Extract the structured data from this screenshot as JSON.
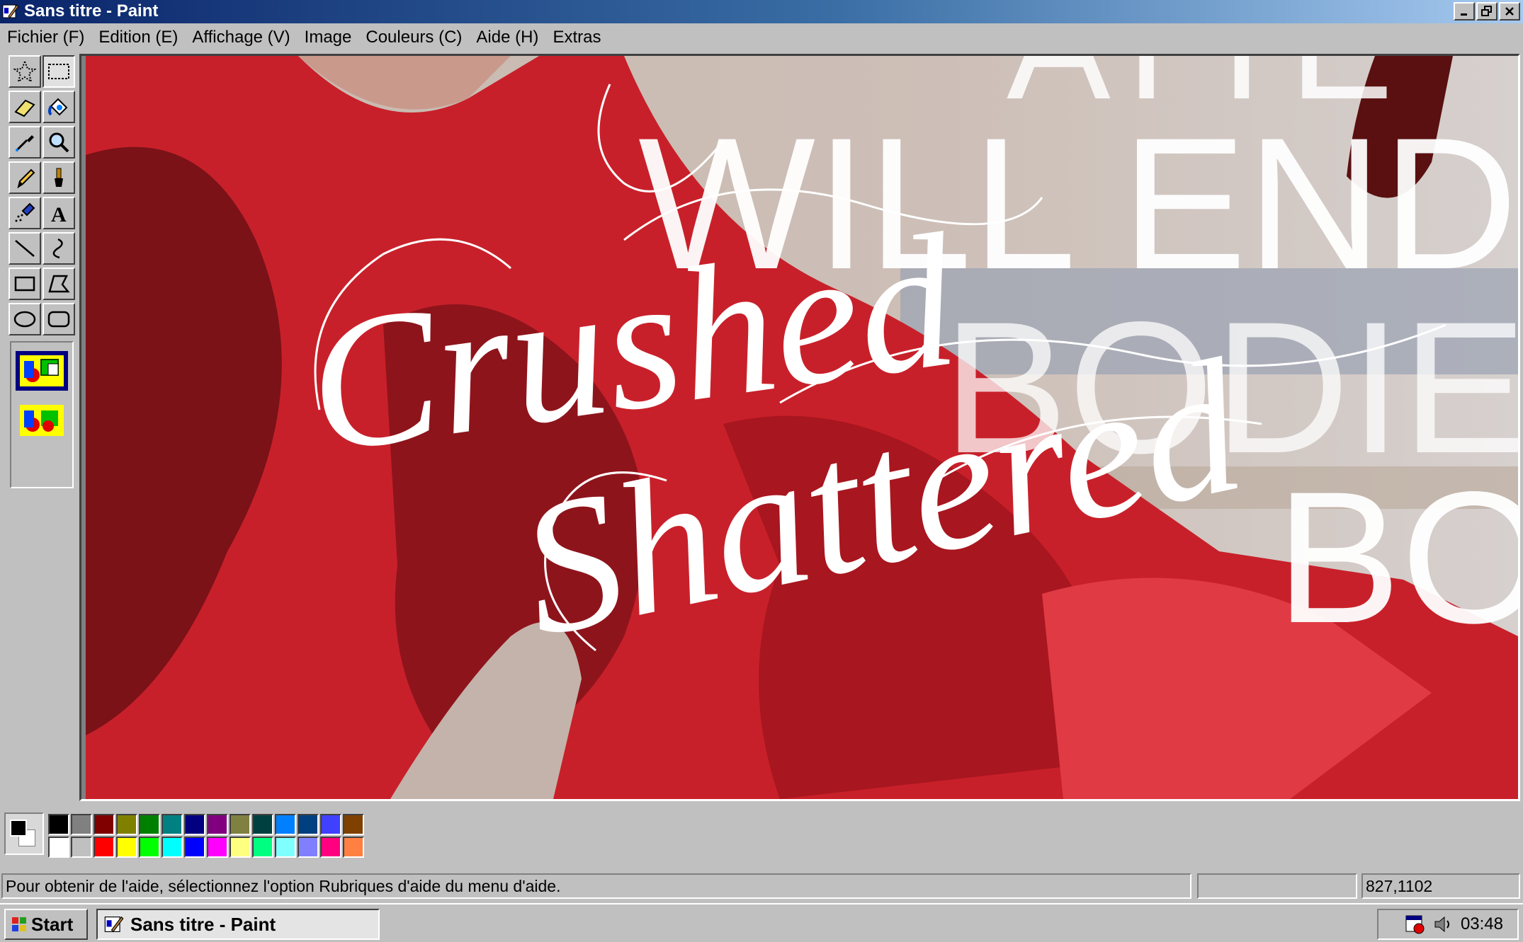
{
  "window": {
    "title": "Sans titre - Paint"
  },
  "menu": [
    "Fichier (F)",
    "Edition (E)",
    "Affichage (V)",
    "Image",
    "Couleurs (C)",
    "Aide (H)",
    "Extras"
  ],
  "tools": [
    {
      "name": "free-select",
      "icon": "star-select-icon"
    },
    {
      "name": "rect-select",
      "icon": "dotted-rect-icon"
    },
    {
      "name": "eraser",
      "icon": "eraser-icon"
    },
    {
      "name": "fill",
      "icon": "paint-bucket-icon"
    },
    {
      "name": "pick-color",
      "icon": "eyedropper-icon"
    },
    {
      "name": "magnifier",
      "icon": "magnifier-icon"
    },
    {
      "name": "pencil",
      "icon": "pencil-icon"
    },
    {
      "name": "brush",
      "icon": "brush-icon"
    },
    {
      "name": "airbrush",
      "icon": "airbrush-icon"
    },
    {
      "name": "text",
      "icon": "text-icon"
    },
    {
      "name": "line",
      "icon": "line-icon"
    },
    {
      "name": "curve",
      "icon": "curve-icon"
    },
    {
      "name": "rectangle",
      "icon": "rectangle-icon"
    },
    {
      "name": "polygon",
      "icon": "polygon-icon"
    },
    {
      "name": "ellipse",
      "icon": "ellipse-icon"
    },
    {
      "name": "rounded-rect",
      "icon": "rounded-rectangle-icon"
    }
  ],
  "active_tool": "rect-select",
  "canvas_artwork": {
    "script_text_1": "Crushed",
    "script_text_2": "Shattered",
    "block_text_1": "WILL END",
    "block_text_2": "BODIE",
    "block_text_3": "BO",
    "block_text_top": "ATTE"
  },
  "palette": {
    "foreground": "#000000",
    "background": "#ffffff",
    "row1": [
      "#000000",
      "#808080",
      "#800000",
      "#808000",
      "#008000",
      "#008080",
      "#000080",
      "#800080",
      "#808040",
      "#004040",
      "#0080ff",
      "#004080",
      "#4040ff",
      "#804000"
    ],
    "row2": [
      "#ffffff",
      "#c0c0c0",
      "#ff0000",
      "#ffff00",
      "#00ff00",
      "#00ffff",
      "#0000ff",
      "#ff00ff",
      "#ffff80",
      "#00ff80",
      "#80ffff",
      "#8080ff",
      "#ff0080",
      "#ff8040"
    ]
  },
  "status": {
    "help": "Pour obtenir de l'aide, sélectionnez l'option Rubriques d'aide du menu d'aide.",
    "size": "",
    "coords": "827,1102"
  },
  "taskbar": {
    "start_label": "Start",
    "task_label": "Sans titre - Paint",
    "clock": "03:48"
  }
}
